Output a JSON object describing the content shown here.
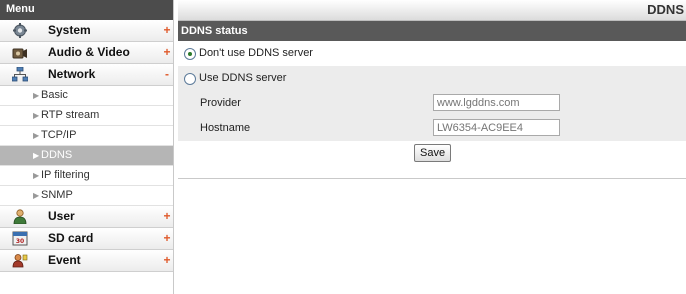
{
  "sidebar": {
    "title": "Menu",
    "categories": [
      {
        "label": "System",
        "sign": "+",
        "icon": "gear-icon",
        "expanded": false
      },
      {
        "label": "Audio & Video",
        "sign": "+",
        "icon": "camera-icon",
        "expanded": false
      },
      {
        "label": "Network",
        "sign": "-",
        "icon": "network-icon",
        "expanded": true
      },
      {
        "label": "User",
        "sign": "+",
        "icon": "user-icon",
        "expanded": false
      },
      {
        "label": "SD card",
        "sign": "+",
        "icon": "sd-card-icon",
        "expanded": false
      },
      {
        "label": "Event",
        "sign": "+",
        "icon": "event-icon",
        "expanded": false
      }
    ],
    "network_items": [
      {
        "label": "Basic",
        "active": false
      },
      {
        "label": "RTP stream",
        "active": false
      },
      {
        "label": "TCP/IP",
        "active": false
      },
      {
        "label": "DDNS",
        "active": true
      },
      {
        "label": "IP filtering",
        "active": false
      },
      {
        "label": "SNMP",
        "active": false
      }
    ],
    "submenu_arrow": "▶"
  },
  "main": {
    "page_title": "DDNS",
    "section_header": "DDNS status",
    "options": {
      "dont_use": {
        "label": "Don't use DDNS server",
        "selected": true
      },
      "use": {
        "label": "Use DDNS server",
        "selected": false
      }
    },
    "provider": {
      "label": "Provider",
      "placeholder": "www.lgddns.com",
      "value": ""
    },
    "hostname": {
      "label": "Hostname",
      "placeholder": "LW6354-AC9EE4",
      "value": ""
    },
    "save_label": "Save"
  },
  "colors": {
    "header_dark": "#4c4c4c",
    "section_header": "#595959",
    "active_item": "#b5b5b5",
    "expand_sign": "#e05a2b",
    "radio_selected": "#2b7a2b"
  }
}
